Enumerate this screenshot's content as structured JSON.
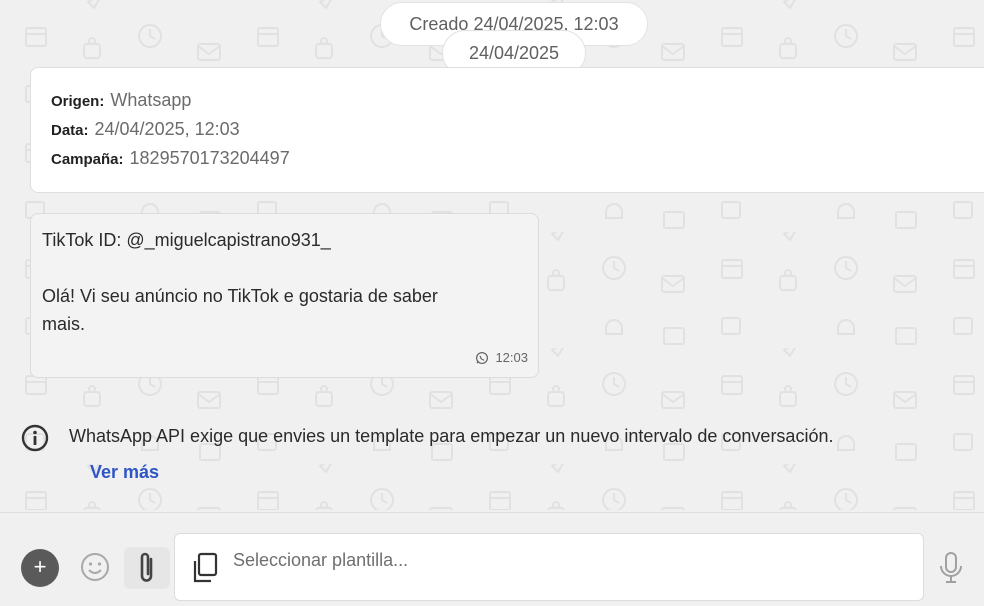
{
  "chat": {
    "created_label": "Creado 24/04/2025, 12:03",
    "date_separator": "24/04/2025"
  },
  "info_card": {
    "origin_label": "Origen:",
    "origin_value": "Whatsapp",
    "date_label": "Data:",
    "date_value": "24/04/2025, 12:03",
    "campaign_label": "Campaña:",
    "campaign_value": "1829570173204497"
  },
  "message": {
    "line1": "TikTok ID: @_miguelcapistrano931_",
    "line2": "Olá! Vi seu anúncio no TikTok e gostaria de saber",
    "line3": "mais.",
    "time": "12:03",
    "channel_icon": "whatsapp-icon"
  },
  "notice": {
    "text": "WhatsApp API exige que envies un template para empezar un nuevo intervalo de conversación.",
    "more_link": "Ver más",
    "icon": "info-icon"
  },
  "composer": {
    "plus_label": "+",
    "template_placeholder": "Seleccionar plantilla...",
    "icons": [
      "plus-icon",
      "emoji-icon",
      "paperclip-icon",
      "copy-icon",
      "microphone-icon"
    ]
  },
  "colors": {
    "link": "#2f55c6",
    "background": "#f0f0f0",
    "plus_button": "#5a5a5a"
  }
}
